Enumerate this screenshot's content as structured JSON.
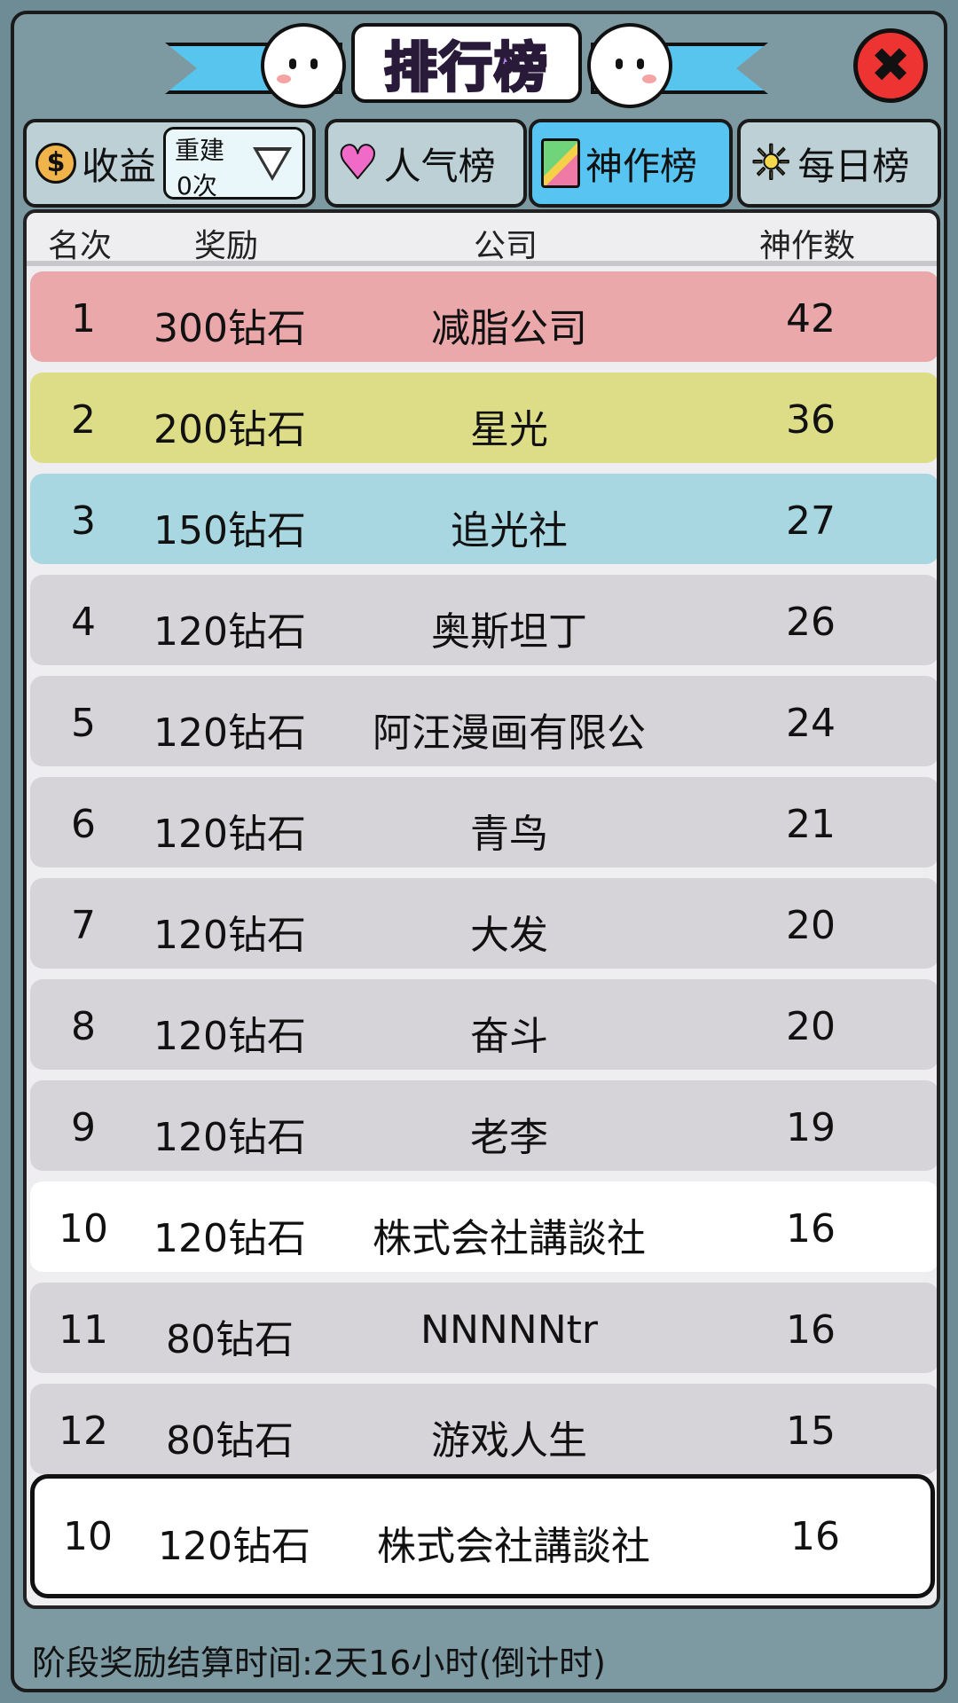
{
  "title": "排行榜",
  "tabs": {
    "revenue": {
      "label": "收益",
      "coin_symbol": "$",
      "rebuild_label": "重建",
      "rebuild_value": "0次"
    },
    "popular": {
      "label": "人气榜"
    },
    "masterpiece": {
      "label": "神作榜"
    },
    "daily": {
      "label": "每日榜"
    }
  },
  "columns": {
    "rank": "名次",
    "reward": "奖励",
    "company": "公司",
    "count": "神作数"
  },
  "rows": [
    {
      "rank": "1",
      "reward": "300钻石",
      "company": "减脂公司",
      "count": "42"
    },
    {
      "rank": "2",
      "reward": "200钻石",
      "company": "星光",
      "count": "36"
    },
    {
      "rank": "3",
      "reward": "150钻石",
      "company": "追光社",
      "count": "27"
    },
    {
      "rank": "4",
      "reward": "120钻石",
      "company": "奥斯坦丁",
      "count": "26"
    },
    {
      "rank": "5",
      "reward": "120钻石",
      "company": "阿汪漫画有限公",
      "count": "24"
    },
    {
      "rank": "6",
      "reward": "120钻石",
      "company": "青鸟",
      "count": "21"
    },
    {
      "rank": "7",
      "reward": "120钻石",
      "company": "大发",
      "count": "20"
    },
    {
      "rank": "8",
      "reward": "120钻石",
      "company": "奋斗",
      "count": "20"
    },
    {
      "rank": "9",
      "reward": "120钻石",
      "company": "老李",
      "count": "19"
    },
    {
      "rank": "10",
      "reward": "120钻石",
      "company": "株式会社講談社",
      "count": "16"
    },
    {
      "rank": "11",
      "reward": "80钻石",
      "company": "NNNNNtr",
      "count": "16"
    },
    {
      "rank": "12",
      "reward": "80钻石",
      "company": "游戏人生",
      "count": "15"
    }
  ],
  "my_rank": {
    "rank": "10",
    "reward": "120钻石",
    "company": "株式会社講談社",
    "count": "16"
  },
  "footer": "阶段奖励结算时间:2天16小时(倒计时)",
  "close_icon": "close-icon",
  "colors": {
    "rank1": "#eaa8aa",
    "rank2": "#dedd87",
    "rank3": "#a9d7e1",
    "active_tab": "#57c4f2"
  }
}
